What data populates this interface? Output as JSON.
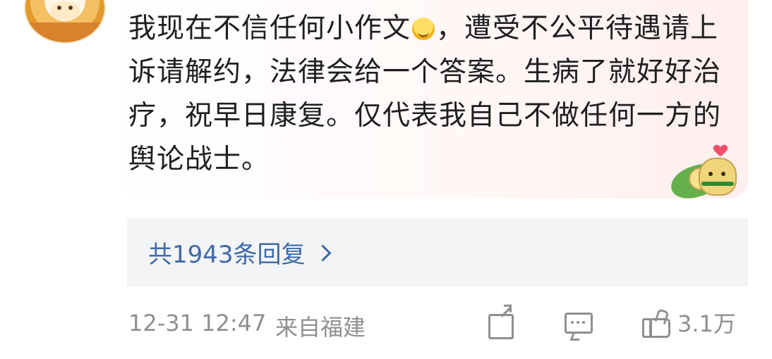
{
  "comment": {
    "text_part1": "我现在不信任何小作文",
    "text_part2": "，遭受不公平待遇请上诉请解约，法律会给一个答案。生病了就好好治疗，祝早日康复。仅代表我自己不做任何一方的舆论战士。",
    "inline_emoji": "laughing-with-tears-emoji",
    "decor_sticker": "zongzi-sticker"
  },
  "replies": {
    "label": "共1943条回复"
  },
  "meta": {
    "time": "12-31 12:47",
    "location": "来自福建"
  },
  "actions": {
    "like_count": "3.1万",
    "share_icon": "share-icon",
    "comment_icon": "comment-icon",
    "like_icon": "thumbs-up-icon"
  },
  "colors": {
    "reply_link": "#3f6aa6",
    "meta_text": "#8f8f8f"
  }
}
